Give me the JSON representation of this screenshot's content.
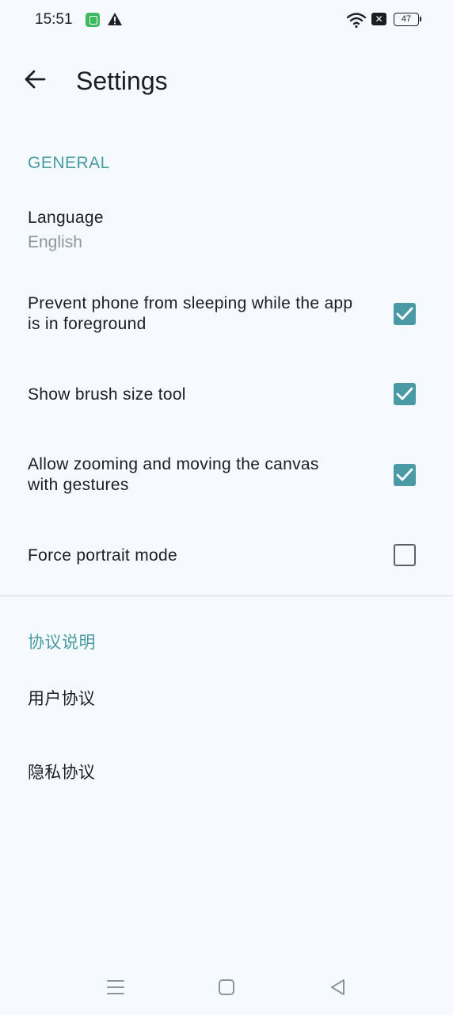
{
  "status_bar": {
    "time": "15:51",
    "battery": "47",
    "icons": [
      "app-notification-icon",
      "warning-icon",
      "wifi-icon",
      "no-sim-icon",
      "battery-icon"
    ]
  },
  "app_bar": {
    "title": "Settings",
    "back_icon": "arrow-left-icon"
  },
  "sections": {
    "general": {
      "header": "GENERAL",
      "language": {
        "title": "Language",
        "summary": "English"
      },
      "prevent_sleep": {
        "title_line1": "Prevent phone from sleeping while the app",
        "title_line2": "is in foreground",
        "checked": true
      },
      "brush_size": {
        "title": "Show brush size tool",
        "checked": true
      },
      "gestures": {
        "title_line1": "Allow zooming and moving the canvas",
        "title_line2": "with gestures",
        "checked": true
      },
      "portrait": {
        "title": "Force portrait mode",
        "checked": false
      }
    },
    "agreements": {
      "header": "协议说明",
      "user_agreement": "用户协议",
      "privacy_agreement": "隐私协议"
    }
  },
  "nav_bar": {
    "icons": [
      "menu-icon",
      "home-icon",
      "back-triangle-icon"
    ]
  },
  "colors": {
    "accent": "#4a9aa5",
    "background": "#f5fbfd",
    "text": "#1b1f22",
    "secondary_text": "#8e9599"
  }
}
